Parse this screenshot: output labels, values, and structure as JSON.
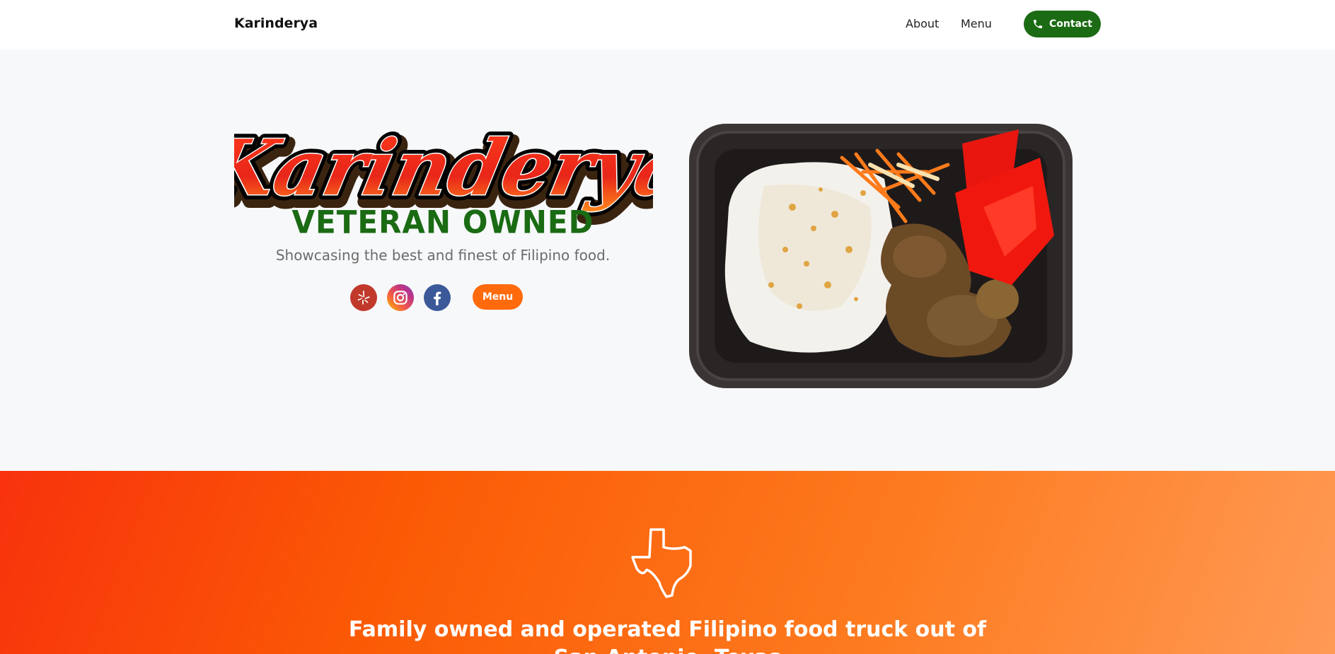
{
  "navbar": {
    "brand": "Karinderya",
    "links": [
      "About",
      "Menu"
    ],
    "contact_label": "Contact"
  },
  "hero": {
    "logo_text": "Karinderya",
    "subtitle": "VETERAN OWNED",
    "tagline": "Showcasing the best and finest of Filipino food.",
    "social": [
      "yelp-icon",
      "instagram-icon",
      "facebook-icon"
    ],
    "menu_button": "Menu"
  },
  "band": {
    "line1": "Family owned and operated Filipino food truck out of",
    "line2": "San Antonio, Texas"
  },
  "colors": {
    "primary_green": "#1a6b13",
    "accent_orange": "#ff6a0d",
    "logo_red": "#e8261a"
  }
}
